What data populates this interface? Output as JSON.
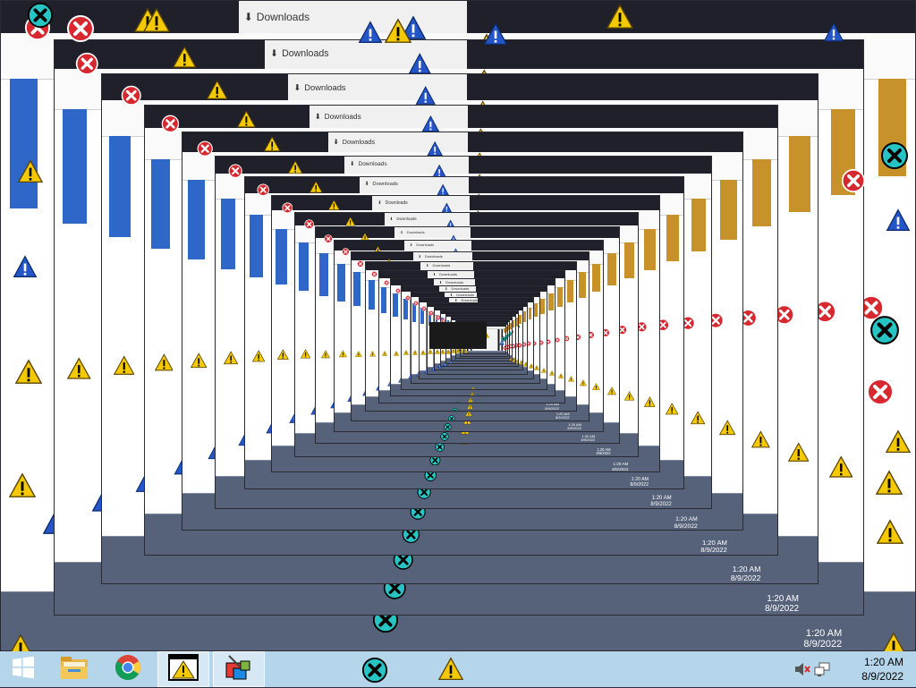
{
  "window": {
    "tab_title": "Downloads",
    "new_tab_symbol": "+",
    "close_tab_symbol": "×",
    "minimize_symbol": "—",
    "close_symbol": "✕"
  },
  "taskbar": {
    "apps": [
      {
        "name": "file-explorer",
        "label": "File Explorer"
      },
      {
        "name": "chrome",
        "label": "Google Chrome"
      },
      {
        "name": "warning-app",
        "label": "Warning"
      },
      {
        "name": "paint-app",
        "label": "Paint"
      }
    ],
    "clock": {
      "time": "1:20 AM",
      "date": "8/9/2022"
    }
  },
  "colors": {
    "taskbar": "#b5d6ea",
    "warning": "#f4c900",
    "error": "#d7282f",
    "info": "#2456c9",
    "teal": "#27c4c4"
  },
  "icons": [
    "windows-logo-icon",
    "folder-icon",
    "chrome-icon",
    "warning-icon",
    "error-icon",
    "info-icon",
    "paint-icon",
    "speaker-muted-icon",
    "network-icon"
  ]
}
